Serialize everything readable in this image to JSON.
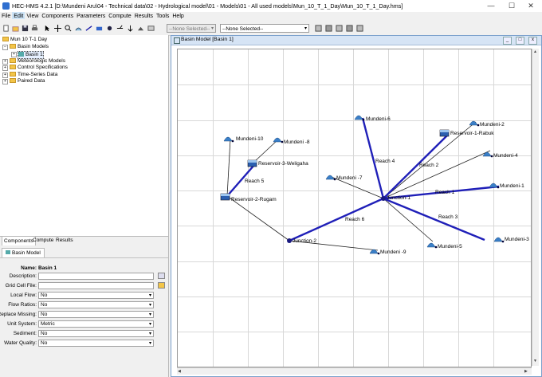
{
  "window": {
    "title": "HEC-HMS 4.2.1 [D:\\Mundeni Aru\\04 - Technical data\\02 - Hydrological model\\01 - Models\\01 - All used models\\Mun_10_T_1_Day\\Mun_10_T_1_Day.hms]",
    "minimize": "—",
    "maximize": "☐",
    "close": "✕"
  },
  "menu": [
    "File",
    "Edit",
    "View",
    "Components",
    "Parameters",
    "Compute",
    "Results",
    "Tools",
    "Help"
  ],
  "toolbar": {
    "combo1": "--None Selected--",
    "combo2": "--None Selected--"
  },
  "tree": {
    "project": "Mun 10 T-1 Day",
    "basin_models": "Basin Models",
    "basin1": "Basin 1",
    "met_models": "Meteorologic Models",
    "control_specs": "Control Specifications",
    "time_series": "Time-Series Data",
    "paired": "Paired Data"
  },
  "left_tabs": [
    "Components",
    "Compute",
    "Results"
  ],
  "editor": {
    "tab": "Basin Model",
    "name_label": "Name:",
    "name_value": "Basin 1",
    "fields": [
      {
        "label": "Description:",
        "value": "",
        "type": "text"
      },
      {
        "label": "Grid Cell File:",
        "value": "",
        "type": "text"
      },
      {
        "label": "Local Flow:",
        "value": "No",
        "type": "select"
      },
      {
        "label": "Flow Ratios:",
        "value": "No",
        "type": "select"
      },
      {
        "label": "Replace Missing:",
        "value": "No",
        "type": "select"
      },
      {
        "label": "Unit System:",
        "value": "Metric",
        "type": "select"
      },
      {
        "label": "Sediment:",
        "value": "No",
        "type": "select"
      },
      {
        "label": "Water Quality:",
        "value": "No",
        "type": "select"
      }
    ]
  },
  "basin_window": {
    "title": "Basin Model [Basin 1]",
    "btn_min": "_",
    "btn_max": "□",
    "btn_close": "x"
  },
  "network": {
    "subbasins": [
      "Mundeni-10",
      "Mundeni -8",
      "Mundeni-6",
      "Mundeni-2",
      "Mundeni-4",
      "Mundeni -7",
      "Mundeni-1",
      "Mundeni-3",
      "Mundeni-5",
      "Mundeni -9"
    ],
    "reservoirs": [
      "Reservoir-3-Weligaha",
      "Reservoir-2-Rugam",
      "Reservoir-1-Rabuk"
    ],
    "junctions": [
      "Junction-1",
      "Junction-2"
    ],
    "reaches": [
      "Reach 5",
      "Reach 4",
      "Reach 2",
      "Reach 1",
      "Reach 3",
      "Reach 6"
    ]
  },
  "colors": {
    "reach": "#1f1fb8",
    "link": "#222222",
    "subbasin_icon": "#3a7fc8",
    "reservoir_icon": "#2b5fb0",
    "folder": "#f3c548"
  }
}
